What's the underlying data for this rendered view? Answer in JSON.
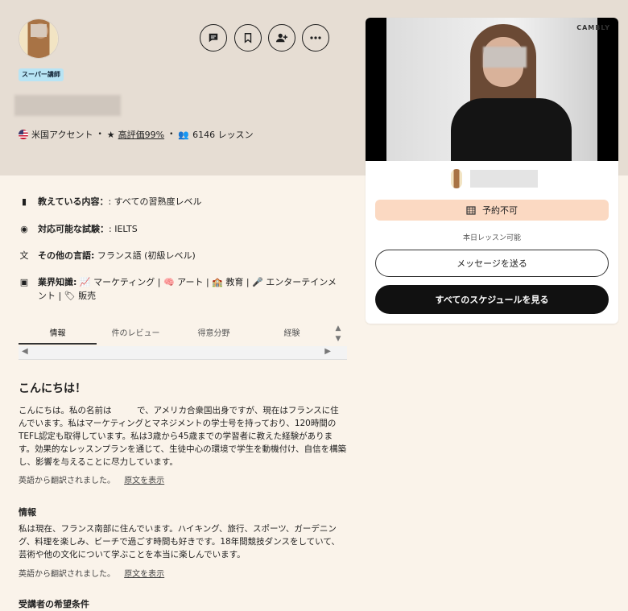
{
  "profile": {
    "badge": "スーパー講師",
    "accent": "米国アクセント",
    "rating_label": "高評価99%",
    "lessons": "6146 レッスン"
  },
  "icons": {
    "message": "chat-icon",
    "save": "bookmark-icon",
    "follow": "person-add-icon",
    "more": "ellipsis-icon"
  },
  "info": {
    "teaches": {
      "label": "教えている内容：",
      "value": ": すべての習熟度レベル"
    },
    "exams": {
      "label": "対応可能な試験：",
      "value": ": IELTS"
    },
    "languages": {
      "label": "その他の言語:",
      "value": "フランス語 (初級レベル)"
    },
    "industry": {
      "label": "業界知識:",
      "items": [
        "マーケティング",
        "アート",
        "教育",
        "エンターテインメント",
        "販売"
      ]
    }
  },
  "tabs": [
    "情報",
    "件のレビュー",
    "得意分野",
    "経験"
  ],
  "intro": {
    "heading": "こんにちは！",
    "body": "こんにちは。私の名前は　　　で、アメリカ合衆国出身ですが、現在はフランスに住んでいます。私はマーケティングとマネジメントの学士号を持っており、120時間のTEFL認定も取得しています。私は3歳から45歳までの学習者に教えた経験があります。効果的なレッスンプランを通じて、生徒中心の環境で学生を動機付け、自信を構築し、影響を与えることに尽力しています。",
    "translated": "英語から翻訳されました。",
    "show_original": "原文を表示"
  },
  "about": {
    "heading": "情報",
    "body": "私は現在、フランス南部に住んでいます。ハイキング、旅行、スポーツ、ガーデニング、料理を楽しみ、ビーチで過ごす時間も好きです。18年間競技ダンスをしていて、芸術や他の文化について学ぶことを本当に楽しんでいます。",
    "translated": "英語から翻訳されました。",
    "show_original": "原文を表示"
  },
  "requirements_heading": "受講者の希望条件",
  "card": {
    "watermark": "CAMBLY",
    "unavailable": "予約不可",
    "availability_note": "本日レッスン可能",
    "message_button": "メッセージを送る",
    "schedule_button": "すべてのスケジュールを見る"
  },
  "colors": {
    "hero_bg": "#e6ddd3",
    "page_bg": "#faf3ea",
    "badge_bg": "#b8e4f4",
    "unavailable_bg": "#fbd9c2",
    "primary_button": "#111111"
  }
}
